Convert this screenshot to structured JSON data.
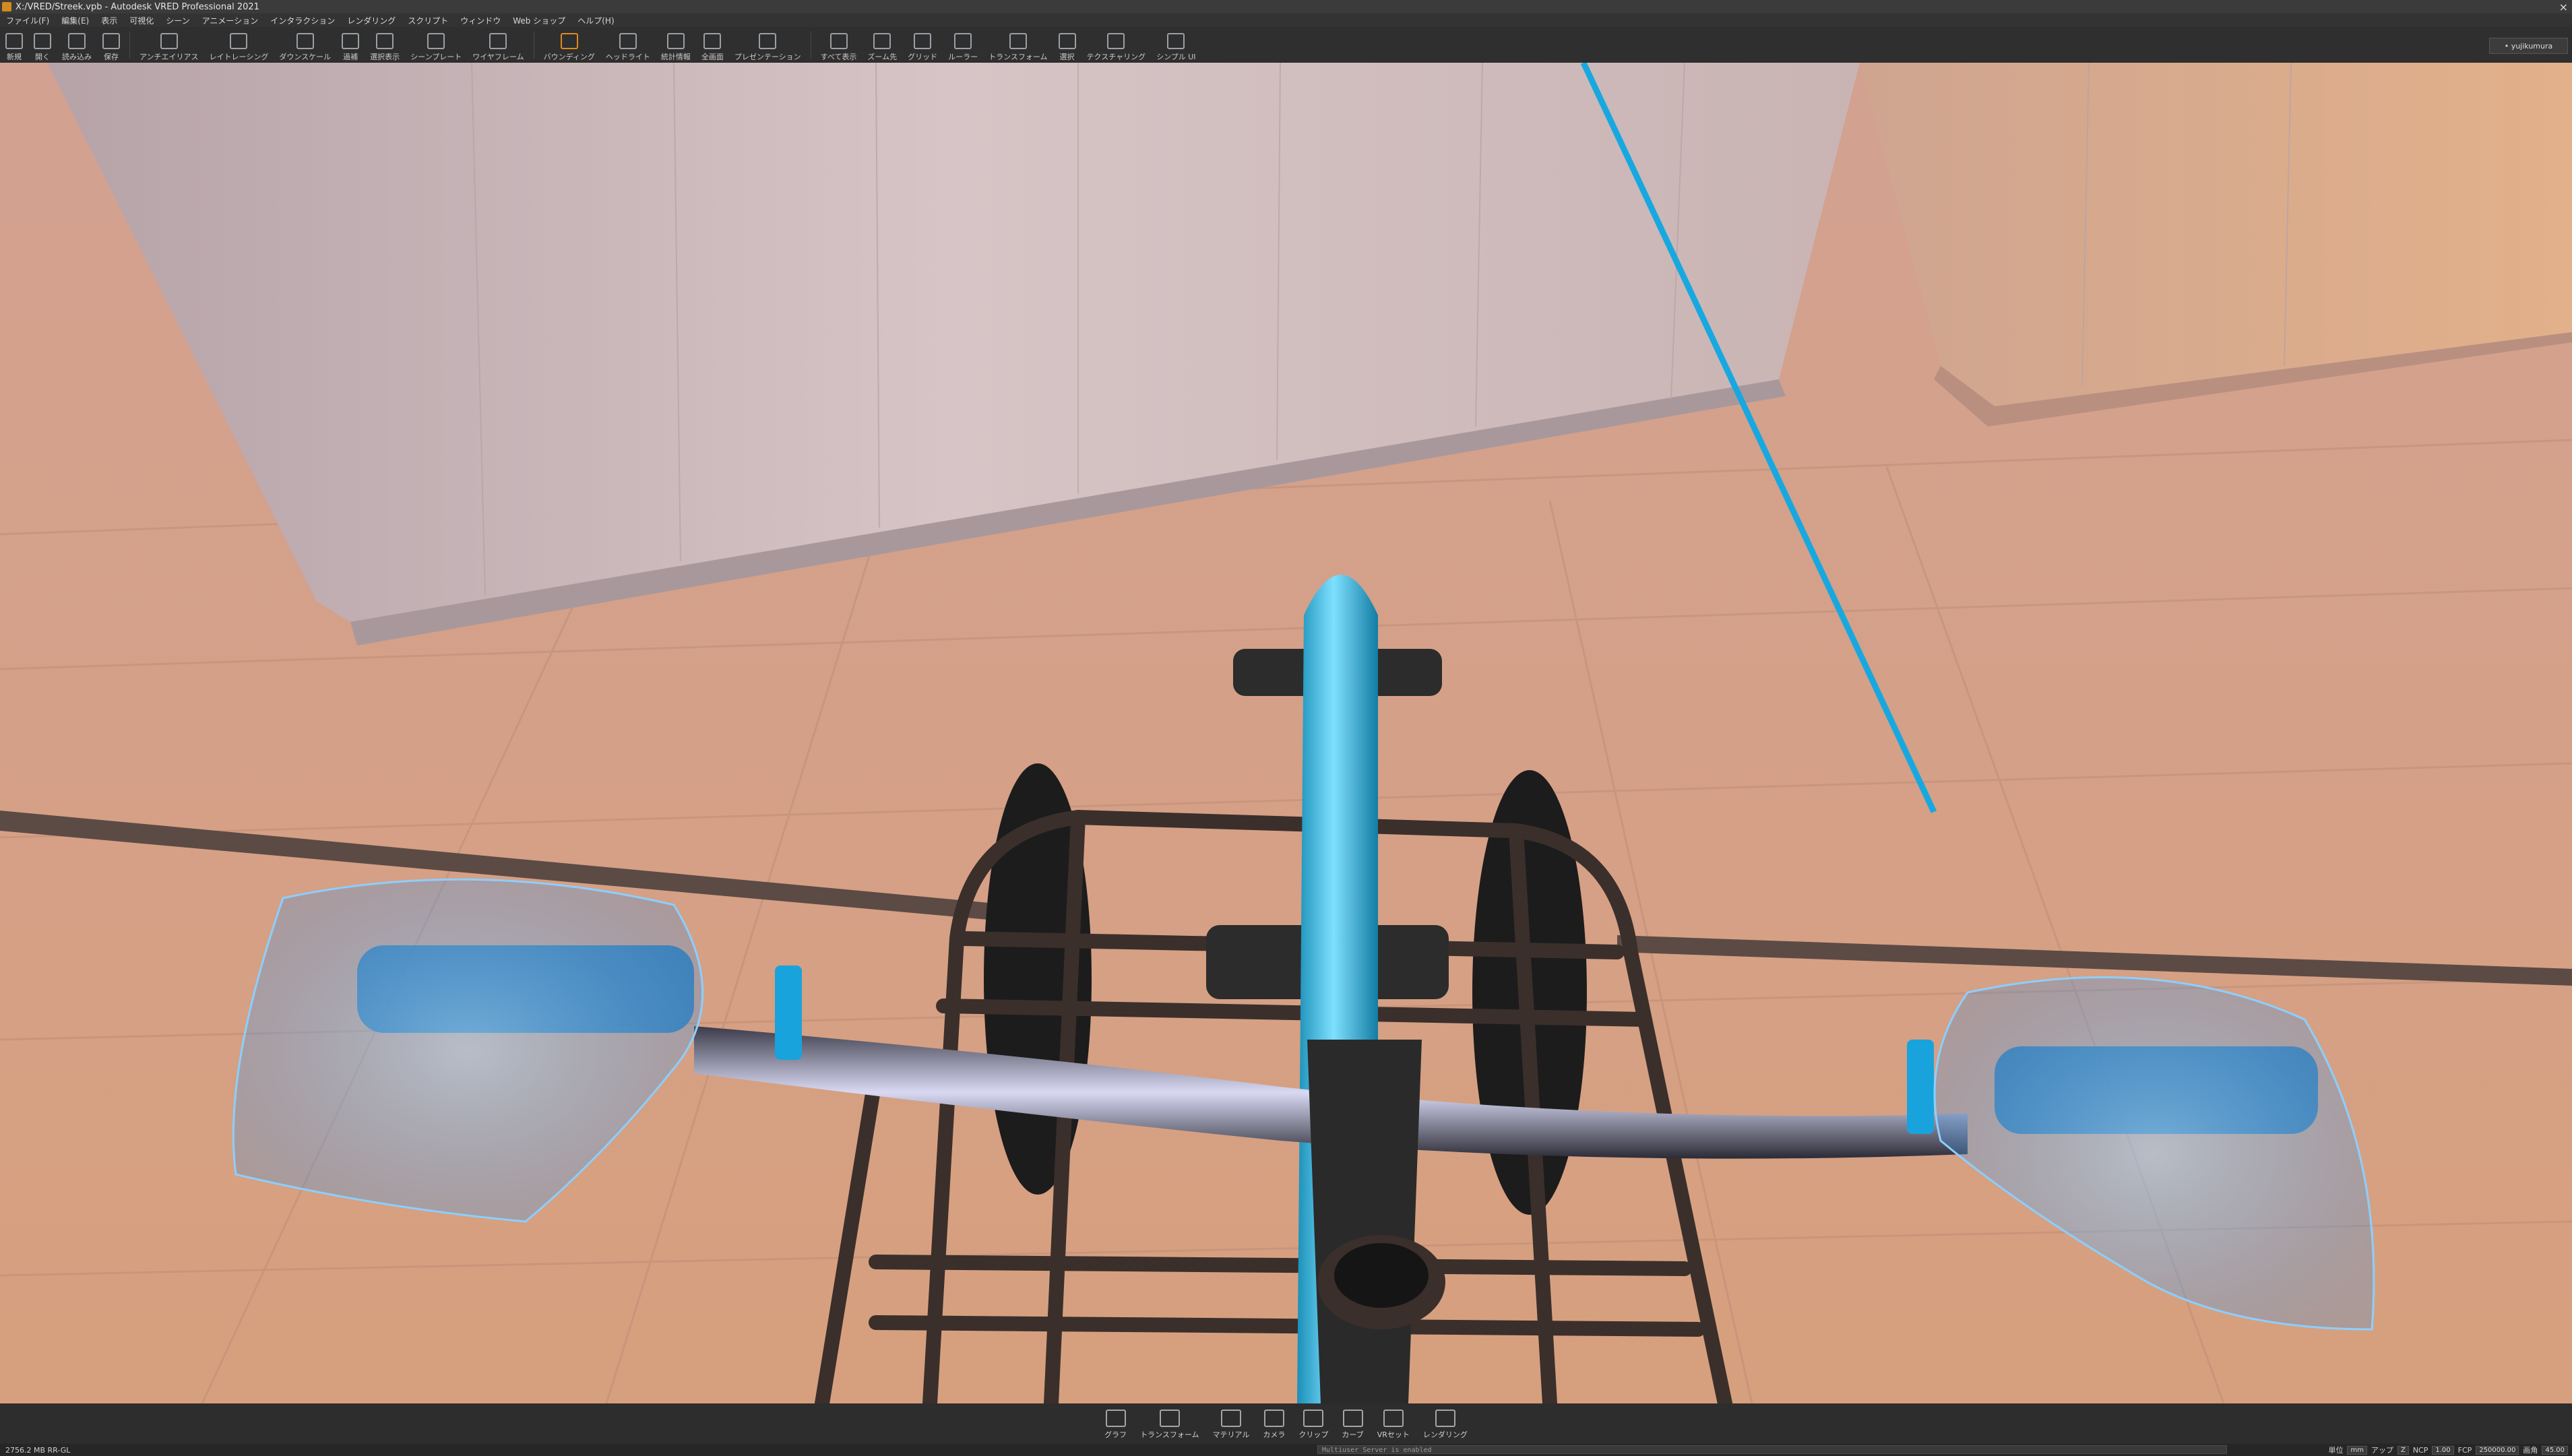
{
  "window": {
    "title": "X:/VRED/Streek.vpb - Autodesk VRED Professional 2021"
  },
  "menu": [
    "ファイル(F)",
    "編集(E)",
    "表示",
    "可視化",
    "シーン",
    "アニメーション",
    "インタラクション",
    "レンダリング",
    "スクリプト",
    "ウィンドウ",
    "Web ショップ",
    "ヘルプ(H)"
  ],
  "toolbar": {
    "buttons": [
      "新規",
      "開く",
      "読み込み",
      "保存",
      "アンチエイリアス",
      "レイトレーシング",
      "ダウンスケール",
      "過補",
      "選択表示",
      "シーンプレート",
      "ワイヤフレーム",
      "バウンディング",
      "ヘッドライト",
      "統計情報",
      "全画面",
      "プレゼンテーション",
      "すべて表示",
      "ズーム先",
      "グリッド",
      "ルーラー",
      "トランスフォーム",
      "選択",
      "テクスチャリング",
      "シンプル UI"
    ],
    "active": "バウンディング"
  },
  "user": {
    "name": "• yujikumura"
  },
  "vr_toolbar": {
    "buttons": [
      "グラフ",
      "トランスフォーム",
      "マテリアル",
      "カメラ",
      "クリップ",
      "カーブ",
      "VRセット",
      "レンダリング"
    ]
  },
  "status": {
    "memory": "2756.2 MB  RR-GL",
    "command": "Multiuser Server is enabled",
    "label_units": "単位",
    "units_value": "mm",
    "label_up": "アップ",
    "up_value": "Z",
    "label_ncp": "NCP",
    "ncp_value": "1.00",
    "label_fcp": "FCP",
    "fcp_value": "250000.00",
    "label_fov": "画角",
    "fov_value": "45.00"
  },
  "colors": {
    "accent_cyan": "#18a8e0",
    "toolbar_active": "#e08a1e"
  }
}
